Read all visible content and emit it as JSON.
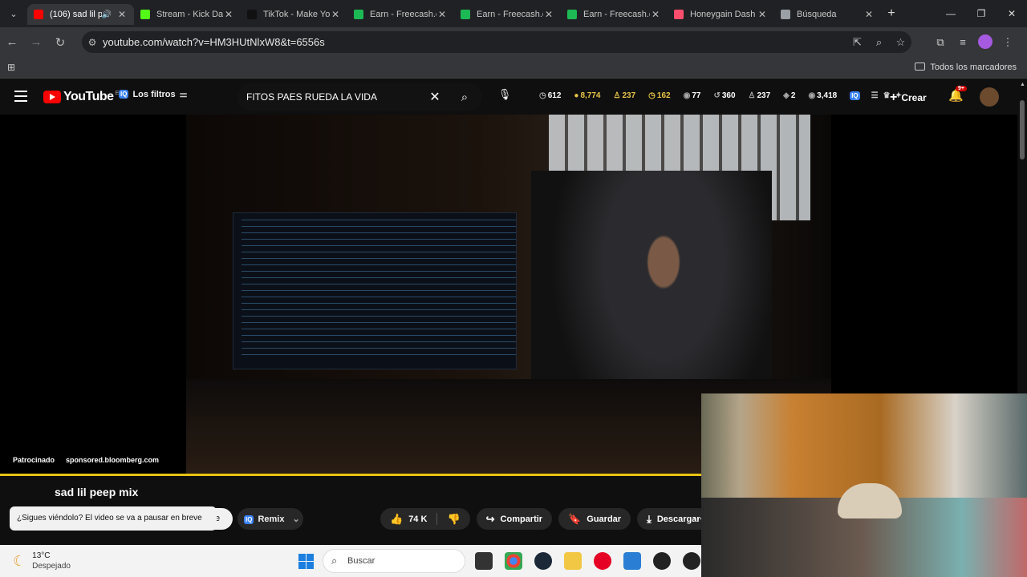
{
  "tabs": [
    {
      "title": "(106) sad lil p",
      "color": "#ff0000",
      "active": true,
      "audio_icon": "speaker-icon"
    },
    {
      "title": "Stream - Kick Da",
      "color": "#53fc18"
    },
    {
      "title": "TikTok - Make Yo",
      "color": "#111111"
    },
    {
      "title": "Earn - Freecash.c",
      "color": "#1db954"
    },
    {
      "title": "Earn - Freecash.c",
      "color": "#1db954"
    },
    {
      "title": "Earn - Freecash.c",
      "color": "#1db954"
    },
    {
      "title": "Honeygain Dash",
      "color": "#ff4d6d"
    },
    {
      "title": "Búsqueda",
      "color": "#9aa0a6"
    }
  ],
  "address_bar": {
    "url": "youtube.com/watch?v=HM3HUtNlxW8&t=6556s"
  },
  "bookmarks": {
    "all_label": "Todos los marcadores"
  },
  "youtube": {
    "logo_text": "YouTube",
    "region": "ES",
    "filters_label": "Los filtros",
    "filters_badge": "IQ",
    "search_query": "FITOS PAES RUEDA LA VIDA",
    "stats": [
      "612",
      "8,774",
      "237",
      "162",
      "77",
      "360",
      "237",
      "2",
      "3,418"
    ],
    "create_label": "Crear",
    "notif_count": "9+"
  },
  "video": {
    "sponsored_label": "Patrocinado",
    "sponsor_domain": "sponsored.bloomberg.com",
    "title": "sad lil peep mix",
    "toast": "¿Sigues viéndolo? El video se va a pausar en breve",
    "hidden_chip_tail": "e",
    "remix_label": "Remix",
    "likes": "74 K",
    "share_label": "Compartir",
    "save_label": "Guardar",
    "download_label": "Descargar"
  },
  "taskbar": {
    "temp": "13°C",
    "condition": "Despejado",
    "search_label": "Buscar"
  },
  "colors": {
    "accent_progress": "#e8c211",
    "brand": "#ff0000"
  }
}
